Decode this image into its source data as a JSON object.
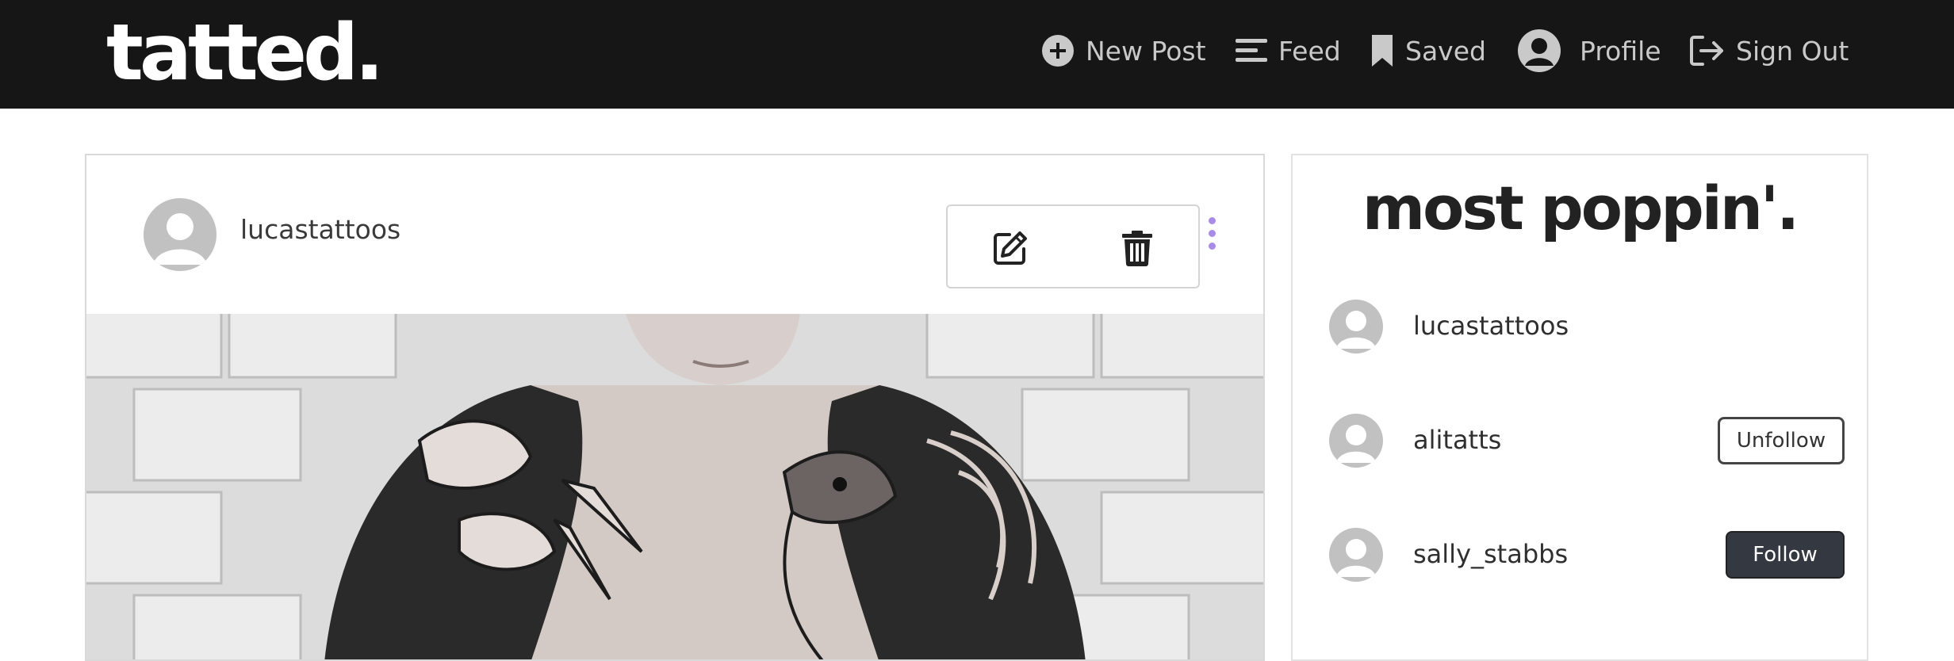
{
  "navbar": {
    "brand": "tatted.",
    "links": [
      {
        "label": "New Post",
        "icon": "plus-circle-icon"
      },
      {
        "label": "Feed",
        "icon": "feed-lines-icon"
      },
      {
        "label": "Saved",
        "icon": "bookmark-icon"
      },
      {
        "label": "Profile",
        "icon": "user-avatar-icon"
      },
      {
        "label": "Sign Out",
        "icon": "sign-out-icon"
      }
    ]
  },
  "post": {
    "username": "lucastattoos",
    "actions": {
      "edit_icon": "edit-icon",
      "delete_icon": "trash-icon",
      "more_icon": "kebab-menu-icon"
    },
    "image": "tattoo-photo"
  },
  "sidebar": {
    "title": "most poppin'.",
    "users": [
      {
        "username": "lucastattoos",
        "button": ""
      },
      {
        "username": "alitatts",
        "button": "Unfollow"
      },
      {
        "username": "sally_stabbs",
        "button": "Follow"
      }
    ]
  },
  "colors": {
    "navbar_bg": "#161616",
    "nav_text": "#c9c9c9",
    "kebab_accent": "#a98be8",
    "follow_btn_bg": "#343840"
  }
}
